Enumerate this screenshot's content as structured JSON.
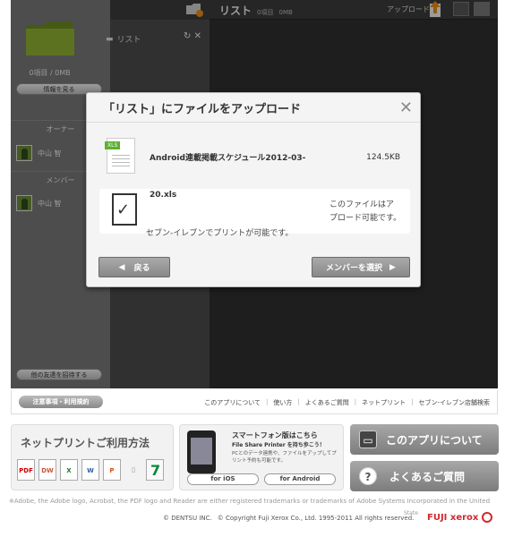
{
  "left_panel": {
    "count": "0項目 / 0MB",
    "info_button": "情報を見る",
    "owner_label": "オーナー",
    "owner_name": "中山 智",
    "member_label": "メンバー",
    "member_name": "中山 智",
    "invite_button": "他の友達を招待する"
  },
  "mid_panel": {
    "title": "リスト",
    "refresh_icon": "refresh-icon",
    "close_icon": "close-icon"
  },
  "right_panel": {
    "title": "リスト",
    "count": "0項目",
    "size": "0MB",
    "upload_label": "アップロード"
  },
  "modal": {
    "title": "「リスト」にファイルをアップロード",
    "file_name": "Android連載掲載スケジュール2012-03-",
    "file_name_tail": "20.xls",
    "file_size": "124.5KB",
    "badge": "XLS",
    "print_ok_line1": "このファイルはア",
    "print_ok_line2": "プロード可能です。",
    "print_msg": "セブン-イレブンでプリントが可能です。",
    "back_button": "戻る",
    "member_button": "メンバーを選択"
  },
  "footer_nav": {
    "notice_button": "注意事項・利用規約",
    "links": [
      "このアプリについて",
      "使い方",
      "よくあるご質問",
      "ネットプリント",
      "セブン-イレブン店舗検索"
    ]
  },
  "banners": {
    "netprint_title": "ネットプリントご利用方法",
    "netprint_icons": [
      "PDF",
      "DW",
      "X",
      "W",
      "P"
    ],
    "phone_title": "スマートフォン版はこちら",
    "phone_sub": "File Share Printer を持ち歩こう！",
    "phone_desc": "PCとのデータ連携や、ファイルをアップしてプリント予約も可能です。",
    "ios_button": "for iOS",
    "android_button": "for Android",
    "about_button": "このアプリについて",
    "faq_button": "よくあるご質問"
  },
  "footer": {
    "disclaimer": "※Adobe, the Adobe logo, Acrobat, the PDF logo and Reader are either registered trademarks or trademarks of Adobe Systems Incorporated in the United",
    "dentsu": "© DENTSU INC.",
    "copyright": "© Copyright Fuji Xerox Co., Ltd. 1995-2011 All rights reserved.",
    "state": "State",
    "logo_text": "FUJI xerox"
  },
  "colors": {
    "folder": "#7a9a2a",
    "logo_red": "#d0282e",
    "excel_green": "#5cb030"
  }
}
